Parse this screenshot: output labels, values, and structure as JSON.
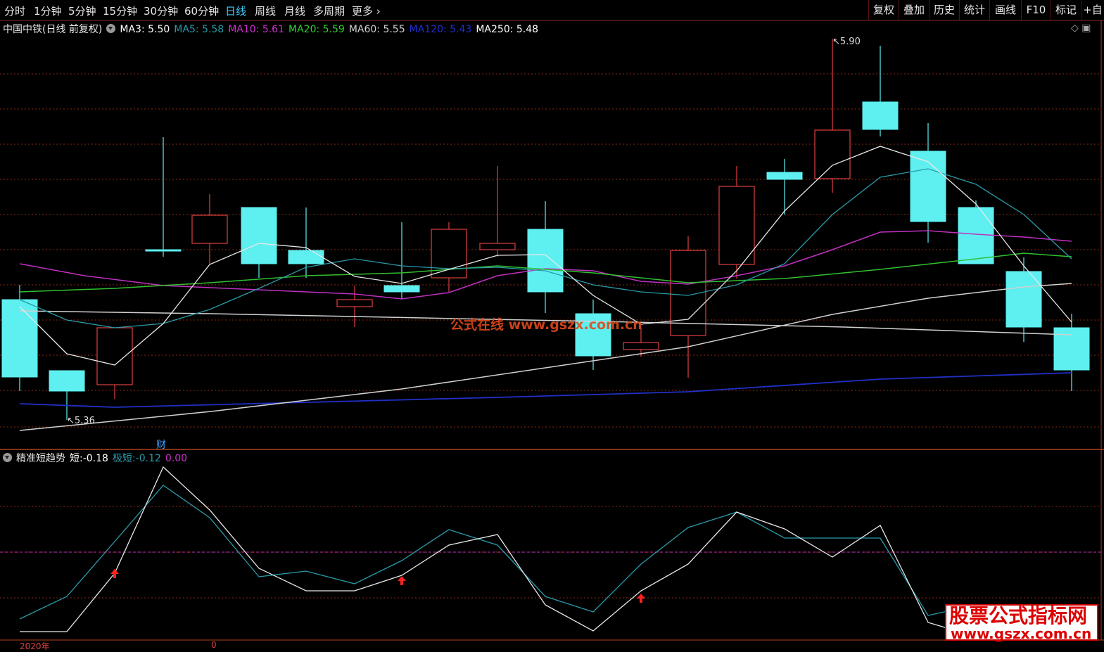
{
  "toolbar": {
    "periods": [
      {
        "label": "分时",
        "active": false
      },
      {
        "label": "1分钟",
        "active": false
      },
      {
        "label": "5分钟",
        "active": false
      },
      {
        "label": "15分钟",
        "active": false
      },
      {
        "label": "30分钟",
        "active": false
      },
      {
        "label": "60分钟",
        "active": false
      },
      {
        "label": "日线",
        "active": true
      },
      {
        "label": "周线",
        "active": false
      },
      {
        "label": "月线",
        "active": false
      },
      {
        "label": "多周期",
        "active": false
      },
      {
        "label": "更多",
        "active": false
      }
    ],
    "more_arrow": "›",
    "right_buttons": [
      "复权",
      "叠加",
      "历史",
      "统计",
      "画线",
      "F10",
      "标记",
      "+自"
    ]
  },
  "main_chart": {
    "title": "中国中铁(日线 前复权)",
    "ma": [
      {
        "label": "MA3:",
        "value": "5.50",
        "color": "#ffffff"
      },
      {
        "label": "MA5:",
        "value": "5.58",
        "color": "#2a9aa8"
      },
      {
        "label": "MA10:",
        "value": "5.61",
        "color": "#d030d0"
      },
      {
        "label": "MA20:",
        "value": "5.59",
        "color": "#30d030"
      },
      {
        "label": "MA60:",
        "value": "5.55",
        "color": "#d0d0d0"
      },
      {
        "label": "MA120:",
        "value": "5.43",
        "color": "#2030d0"
      },
      {
        "label": "MA250:",
        "value": "5.48",
        "color": "#ffffff"
      }
    ],
    "high_label": "5.90",
    "low_label": "5.36",
    "finance_marker": "财",
    "watermark": "公式在线  www.gszx.com.cn",
    "colors": {
      "up": "#e04040",
      "down": "#5ef0f0",
      "grid": "#8a2a10"
    }
  },
  "indicator": {
    "name": "精准短趋势",
    "values": [
      {
        "label": "短:",
        "value": "-0.18",
        "color": "#ffffff"
      },
      {
        "label": "极短:",
        "value": "-0.12",
        "color": "#2a9aa8"
      },
      {
        "label": "",
        "value": "0.00",
        "color": "#d030d0"
      }
    ]
  },
  "bottom_axis": {
    "year_label": "2020年",
    "tick_label": "0"
  },
  "logo": {
    "text": "股票公式指标网",
    "url": "www.gszx.com.cn"
  }
}
